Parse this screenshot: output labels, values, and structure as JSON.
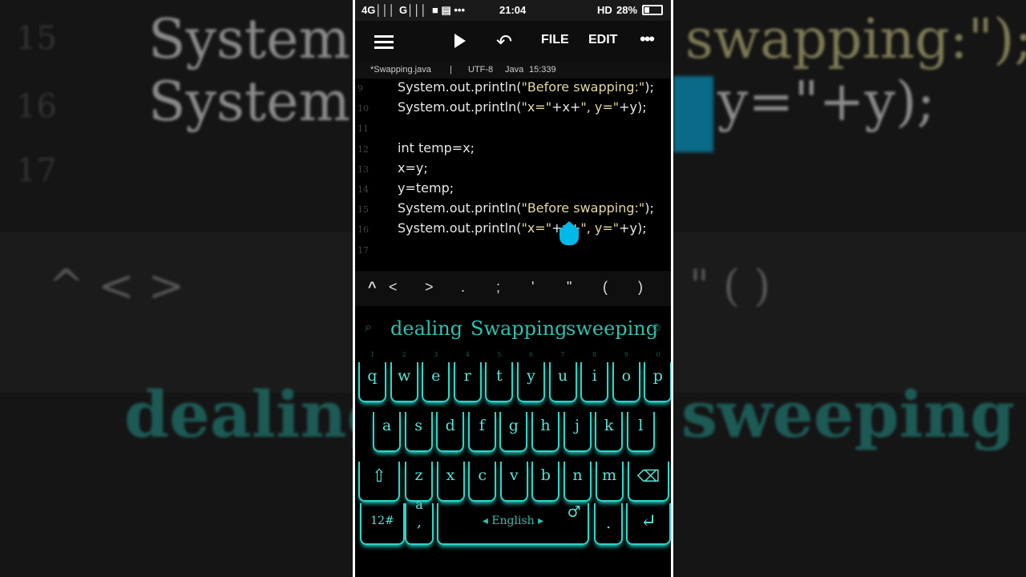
{
  "status": {
    "signal1": "4G│││",
    "signal2": "G│││",
    "icons": "■ ▤ •••",
    "time": "21:04",
    "hd": "HD",
    "battery": "28%",
    "battery_level": 0.28
  },
  "toolbar": {
    "menu_icon": "hamburger-icon",
    "run_icon": "play-icon",
    "undo_icon": "undo-icon",
    "file_label": "FILE",
    "edit_label": "EDIT",
    "more_icon": "•••"
  },
  "fileinfo": {
    "filename": "*Swapping.java",
    "sep": "|",
    "encoding": "UTF-8",
    "language": "Java",
    "position": "15:339"
  },
  "editor": {
    "lines": [
      {
        "num": "9",
        "code": "System.out.println(\"Before swapping:\");"
      },
      {
        "num": "10",
        "code": "System.out.println(\"x=\"+x+\", y=\"+y);"
      },
      {
        "num": "11",
        "code": ""
      },
      {
        "num": "12",
        "code": "int temp=x;"
      },
      {
        "num": "13",
        "code": "x=y;"
      },
      {
        "num": "14",
        "code": "y=temp;"
      },
      {
        "num": "15",
        "code": "System.out.println(\"Before swapping:\");"
      },
      {
        "num": "16",
        "code": "System.out.println(\"x=\"+x+\", y=\"+y);"
      },
      {
        "num": "17",
        "code": ""
      }
    ]
  },
  "symbols": [
    "^",
    "<",
    ">",
    ".",
    ";",
    "'",
    "\"",
    "(",
    ")"
  ],
  "suggestions": [
    "dealing",
    "Swapping",
    "sweeping"
  ],
  "keyboard": {
    "row1": [
      "q",
      "w",
      "e",
      "r",
      "t",
      "y",
      "u",
      "i",
      "o",
      "p"
    ],
    "row1_hints": [
      "1",
      "2",
      "3",
      "4",
      "5",
      "6",
      "7",
      "8",
      "9",
      "0"
    ],
    "row2": [
      "a",
      "s",
      "d",
      "f",
      "g",
      "h",
      "j",
      "k",
      "l"
    ],
    "row3": [
      "z",
      "x",
      "c",
      "v",
      "b",
      "n",
      "m"
    ],
    "shift": "⇧",
    "backspace": "⌫",
    "num_key": "12#",
    "a_key": "a",
    "comma_key": ",",
    "space_label": "◂ English ▸",
    "mic": "♂",
    "period_key": ".",
    "enter": "↵"
  },
  "background": {
    "line15": "System.ou",
    "line16": "System.ou",
    "right_line15": "swapping:\");",
    "right_line16": "y=\"+y);",
    "left_word": "dealing",
    "right_word": "sweeping",
    "ln15": "15",
    "ln16": "16",
    "ln17": "17",
    "left_keys": "^   <     >",
    "right_keys": "\"      (      )"
  }
}
